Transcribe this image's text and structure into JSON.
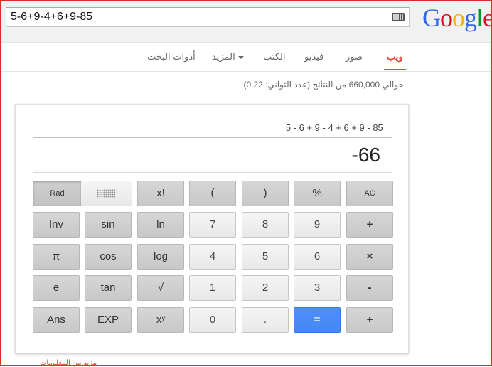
{
  "search": {
    "query": "5-6+9-4+6+9-85"
  },
  "logo": {
    "letters": [
      {
        "ch": "G",
        "color": "#3369e8"
      },
      {
        "ch": "o",
        "color": "#d50f25"
      },
      {
        "ch": "o",
        "color": "#eeb211"
      },
      {
        "ch": "g",
        "color": "#3369e8"
      },
      {
        "ch": "l",
        "color": "#009925"
      },
      {
        "ch": "e",
        "color": "#d50f25"
      }
    ]
  },
  "nav": {
    "web": "ويب",
    "images": "صور",
    "videos": "فيديو",
    "books": "الكتب",
    "more": "المزيد",
    "tools": "أدوات البحث"
  },
  "results_stats": "حوالي 660,000 من النتائج (عدد الثواني: 0.22)",
  "calculator": {
    "expression": "5 - 6 + 9 - 4 + 6 + 9 - 85 =",
    "result": "-66",
    "keys": {
      "rad": "Rad",
      "fact": "x!",
      "lparen": "(",
      "rparen": ")",
      "percent": "%",
      "ac": "AC",
      "inv": "Inv",
      "sin": "sin",
      "ln": "ln",
      "k7": "7",
      "k8": "8",
      "k9": "9",
      "divide": "÷",
      "pi": "π",
      "cos": "cos",
      "log": "log",
      "k4": "4",
      "k5": "5",
      "k6": "6",
      "multiply": "×",
      "e": "e",
      "tan": "tan",
      "sqrt": "√",
      "k1": "1",
      "k2": "2",
      "k3": "3",
      "minus": "-",
      "ans": "Ans",
      "exp": "EXP",
      "pow": "xʸ",
      "k0": "0",
      "dot": ".",
      "equals": "=",
      "plus": "+"
    }
  },
  "more_info": "مزيد من المعلومات"
}
